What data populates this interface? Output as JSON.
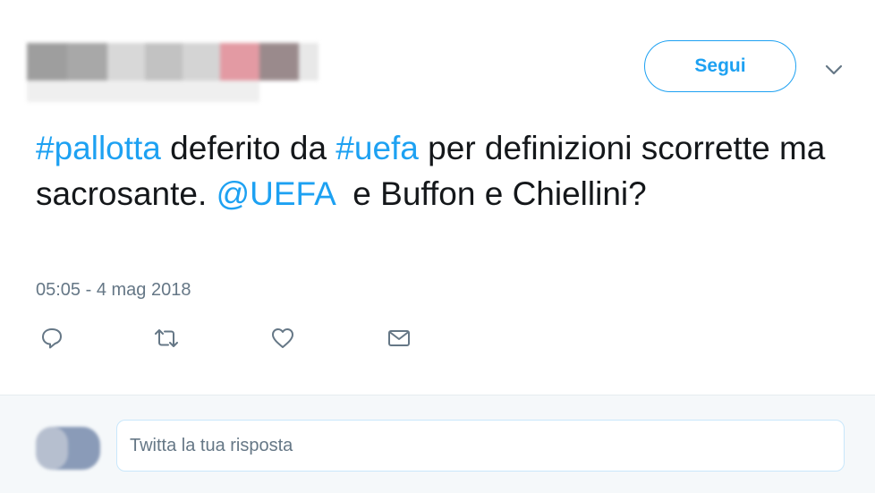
{
  "header": {
    "follow_label": "Segui",
    "menu_icon": "chevron-down-icon"
  },
  "tweet": {
    "segments": [
      {
        "text": "#pallotta",
        "type": "hashtag"
      },
      {
        "text": " deferito da ",
        "type": "text"
      },
      {
        "text": "#uefa",
        "type": "hashtag"
      },
      {
        "text": " per definizioni scorrette ma sacrosante. ",
        "type": "text"
      },
      {
        "text": "@UEFA",
        "type": "mention"
      },
      {
        "text": "  e Buffon e Chiellini?",
        "type": "text"
      }
    ],
    "timestamp": "05:05 - 4 mag 2018"
  },
  "actions": [
    {
      "name": "reply-icon"
    },
    {
      "name": "retweet-icon"
    },
    {
      "name": "like-icon"
    },
    {
      "name": "direct-message-icon"
    }
  ],
  "reply": {
    "placeholder": "Twitta la tua risposta"
  },
  "colors": {
    "accent": "#1da1f2",
    "text": "#14171a",
    "muted": "#657786"
  }
}
